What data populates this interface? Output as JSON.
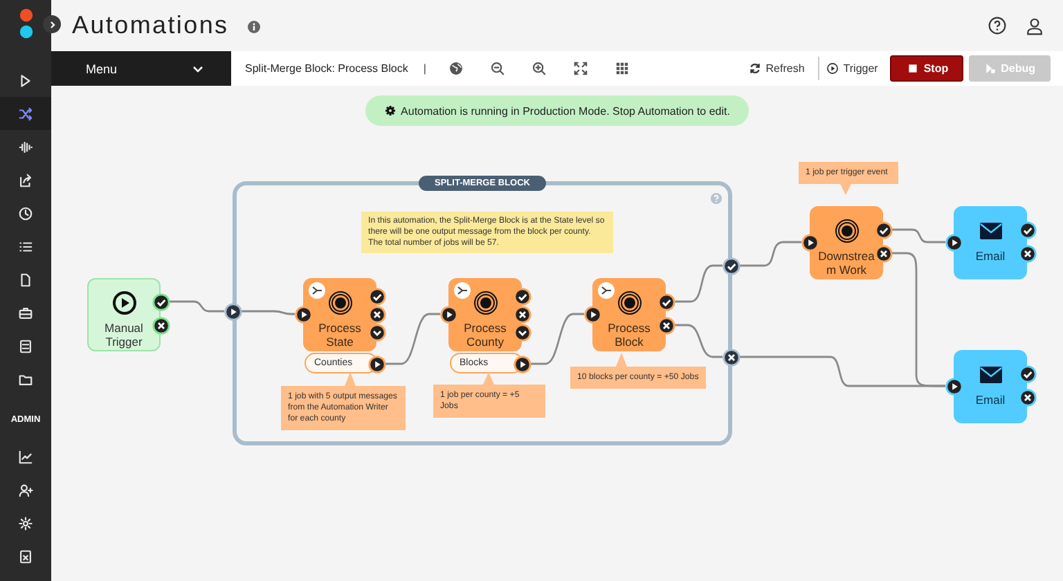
{
  "sidebar": {
    "items": [
      {
        "selected": false
      },
      {
        "selected": true
      },
      {
        "selected": false
      },
      {
        "selected": false
      },
      {
        "selected": false
      },
      {
        "selected": false
      },
      {
        "selected": false
      },
      {
        "selected": false
      },
      {
        "selected": false
      },
      {
        "selected": false
      }
    ],
    "section_label": "ADMIN",
    "admin_items": [
      {
        "selected": false
      },
      {
        "selected": false
      },
      {
        "selected": false
      },
      {
        "selected": false
      }
    ]
  },
  "header": {
    "title": "Automations"
  },
  "toolbar": {
    "menu_label": "Menu",
    "breadcrumb": "Split-Merge Block: Process Block",
    "separator": "|",
    "actions": [
      {
        "kind": "refresh",
        "label": "Refresh",
        "disabled": false
      },
      {
        "kind": "trigger",
        "label": "Trigger",
        "disabled": false
      },
      {
        "kind": "stop",
        "label": "Stop",
        "disabled": false
      },
      {
        "kind": "debug",
        "label": "Debug",
        "disabled": true
      }
    ]
  },
  "banner": "Automation is running in Production Mode. Stop Automation to edit.",
  "diagram": {
    "container": {
      "label": "SPLIT-MERGE BLOCK",
      "note": "In this automation, the Split-Merge Block is at the State level so there will be one output message from the block per county. The total number of jobs will be 57."
    },
    "nodes": [
      {
        "kind": "trigger",
        "label": "Manual Trigger",
        "split": false,
        "expandable": false
      },
      {
        "kind": "process",
        "label": "Process State",
        "split": true,
        "expandable": true,
        "output": "Counties",
        "note": "1 job with 5 output messages from the Automation Writer for each county"
      },
      {
        "kind": "process",
        "label": "Process County",
        "split": true,
        "expandable": true,
        "output": "Blocks",
        "note": "1 job per county = +5 Jobs"
      },
      {
        "kind": "process",
        "label": "Process Block",
        "split": true,
        "expandable": false,
        "note": "10 blocks per county = +50 Jobs"
      },
      {
        "kind": "process",
        "label": "Downstream Work",
        "split": false,
        "expandable": false,
        "note": "1 job per trigger event"
      },
      {
        "kind": "email",
        "label": "Email",
        "split": false,
        "expandable": false
      },
      {
        "kind": "email",
        "label": "Email",
        "split": false,
        "expandable": false
      }
    ]
  }
}
